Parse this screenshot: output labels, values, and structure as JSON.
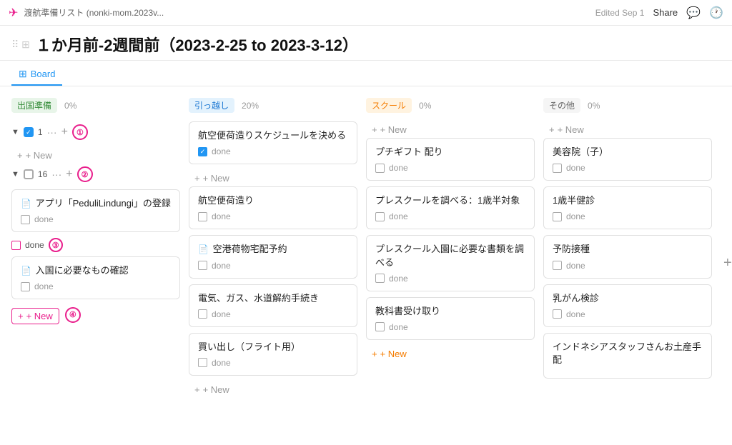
{
  "topbar": {
    "logo": "✈",
    "title": "渡航準備リスト (nonki-mom.2023v...",
    "edited": "Edited Sep 1",
    "share": "Share"
  },
  "page": {
    "title": "１か月前-2週間前（2023-2-25 to 2023-3-12）"
  },
  "viewtab": {
    "label": "Board",
    "icon": "⊞"
  },
  "columns": [
    {
      "id": "col1",
      "title": "出国準備",
      "pct": "0%",
      "pill_class": "pill-green",
      "groups": [
        {
          "id": "g1",
          "type": "checked",
          "count": "1",
          "badge": "①",
          "cards": []
        },
        {
          "id": "g2",
          "type": "unchecked",
          "count": "16",
          "badge": "②",
          "cards": [
            {
              "title": "アプリ「PeduliLindungi」の登録",
              "done": false,
              "doc": true
            },
            {
              "title": "入国に必要なもの確認",
              "done": false,
              "doc": true
            }
          ]
        }
      ],
      "new_label_1": "+ New",
      "new_label_2": "+ New"
    },
    {
      "id": "col2",
      "title": "引っ越し",
      "pct": "20%",
      "pill_class": "pill-blue",
      "cards": [
        {
          "title": "航空便荷造りスケジュールを決める",
          "done": true
        },
        {
          "title": "航空便荷造り",
          "done": false
        },
        {
          "title": "空港荷物宅配予約",
          "done": false,
          "doc": true
        },
        {
          "title": "電気、ガス、水道解約手続き",
          "done": false
        },
        {
          "title": "買い出し（フライト用）",
          "done": false
        }
      ],
      "new_label": "+ New"
    },
    {
      "id": "col3",
      "title": "スクール",
      "pct": "0%",
      "pill_class": "pill-orange",
      "cards": [
        {
          "title": "プチギフト 配り",
          "done": false
        },
        {
          "title": "プレスクールを調べる：1歳半対象",
          "done": false
        },
        {
          "title": "プレスクール入園に必要な書類を調べる",
          "done": false
        },
        {
          "title": "教科書受け取り",
          "done": false
        }
      ],
      "new_label": "+ New"
    },
    {
      "id": "col4",
      "title": "その他",
      "pct": "0%",
      "pill_class": "pill-gray",
      "cards": [
        {
          "title": "美容院（子）",
          "done": false
        },
        {
          "title": "1歳半健診",
          "done": false
        },
        {
          "title": "予防接種",
          "done": false
        },
        {
          "title": "乳がん検診",
          "done": false
        },
        {
          "title": "インドネシアスタッフさんお土産手配",
          "done": false
        }
      ],
      "new_label": "+ New"
    }
  ],
  "add_column": "+"
}
